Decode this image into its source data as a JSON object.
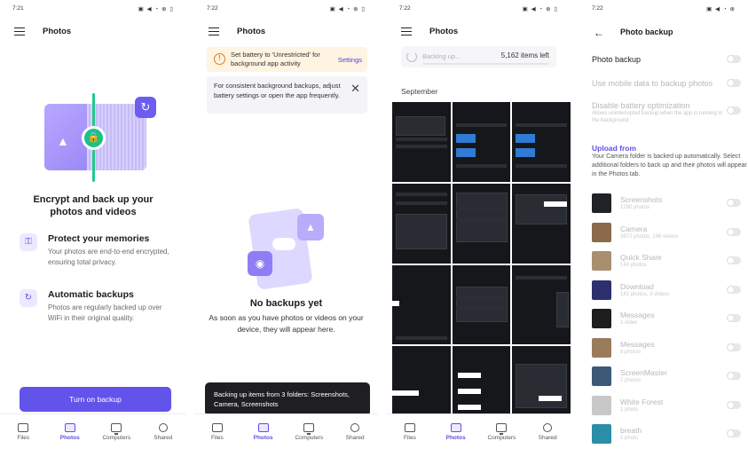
{
  "panel1": {
    "status_time": "7:21",
    "status_icons": "▣ ◀ ◔ ⊕ ▯",
    "title": "Photos",
    "headline": "Encrypt and back up your photos and videos",
    "features": [
      {
        "icon": "lock-icon",
        "title": "Protect your memories",
        "desc": "Your photos are end-to-end encrypted, ensuring total privacy."
      },
      {
        "icon": "sync-icon",
        "title": "Automatic backups",
        "desc": "Photos are regularly backed up over WiFi in their original quality."
      }
    ],
    "cta": "Turn on backup"
  },
  "panel2": {
    "status_time": "7:22",
    "status_icons": "▣ ◀ ◔ ⊕ ▯",
    "title": "Photos",
    "battery_banner": "Set battery to 'Unrestricted' for background app activity",
    "battery_link": "Settings",
    "consistency_banner": "For consistent background backups, adjust battery settings or open the app frequently.",
    "empty_title": "No backups yet",
    "empty_desc": "As soon as you have photos or videos on your device, they will appear here.",
    "toast": "Backing up items from 3 folders: Screenshots, Camera, Screenshots"
  },
  "panel3": {
    "status_time": "7:22",
    "status_icons": "▣ ◀ ◔ ⊕ ▯",
    "title": "Photos",
    "progress_label": "Backing up...",
    "progress_count": "5,162 items left",
    "progress_fraction": 0.0,
    "month": "September"
  },
  "panel4": {
    "status_time": "7:22",
    "status_icons": "▣ ◀ ◔ ⊕",
    "title": "Photo backup",
    "settings": [
      {
        "label": "Photo backup",
        "sub": "",
        "enabled": true
      },
      {
        "label": "Use mobile data to backup photos",
        "sub": "",
        "enabled": false
      },
      {
        "label": "Disable battery optimization",
        "sub": "Allows uninterrupted backup when the app is running in the background.",
        "enabled": false
      }
    ],
    "upload_title": "Upload from",
    "upload_desc": "Your Camera folder is backed up automatically. Select additional folders to back up and their photos will appear in the Photos tab.",
    "folders": [
      {
        "name": "Screenshots",
        "count": "1290 photos",
        "color": "#202228"
      },
      {
        "name": "Camera",
        "count": "3872 photos, 146 videos",
        "color": "#8a6a4a"
      },
      {
        "name": "Quick Share",
        "count": "149 photos",
        "color": "#a88f6e"
      },
      {
        "name": "Download",
        "count": "141 photos, 3 videos",
        "color": "#2d2f6e"
      },
      {
        "name": "Messages",
        "count": "1 video",
        "color": "#1e1e1e"
      },
      {
        "name": "Messages",
        "count": "8 photos",
        "color": "#9a7c5c"
      },
      {
        "name": "ScreenMaster",
        "count": "7 photos",
        "color": "#3c5a78"
      },
      {
        "name": "White Forest",
        "count": "1 photo",
        "color": "#c8c8c8"
      },
      {
        "name": "breath",
        "count": "1 photo",
        "color": "#2a8ea8"
      }
    ]
  },
  "nav": [
    {
      "label": "Files"
    },
    {
      "label": "Photos"
    },
    {
      "label": "Computers"
    },
    {
      "label": "Shared"
    }
  ],
  "colors": {
    "accent": "#6353ea",
    "warning": "#e27a16",
    "toast_bg": "#1f1f23"
  }
}
